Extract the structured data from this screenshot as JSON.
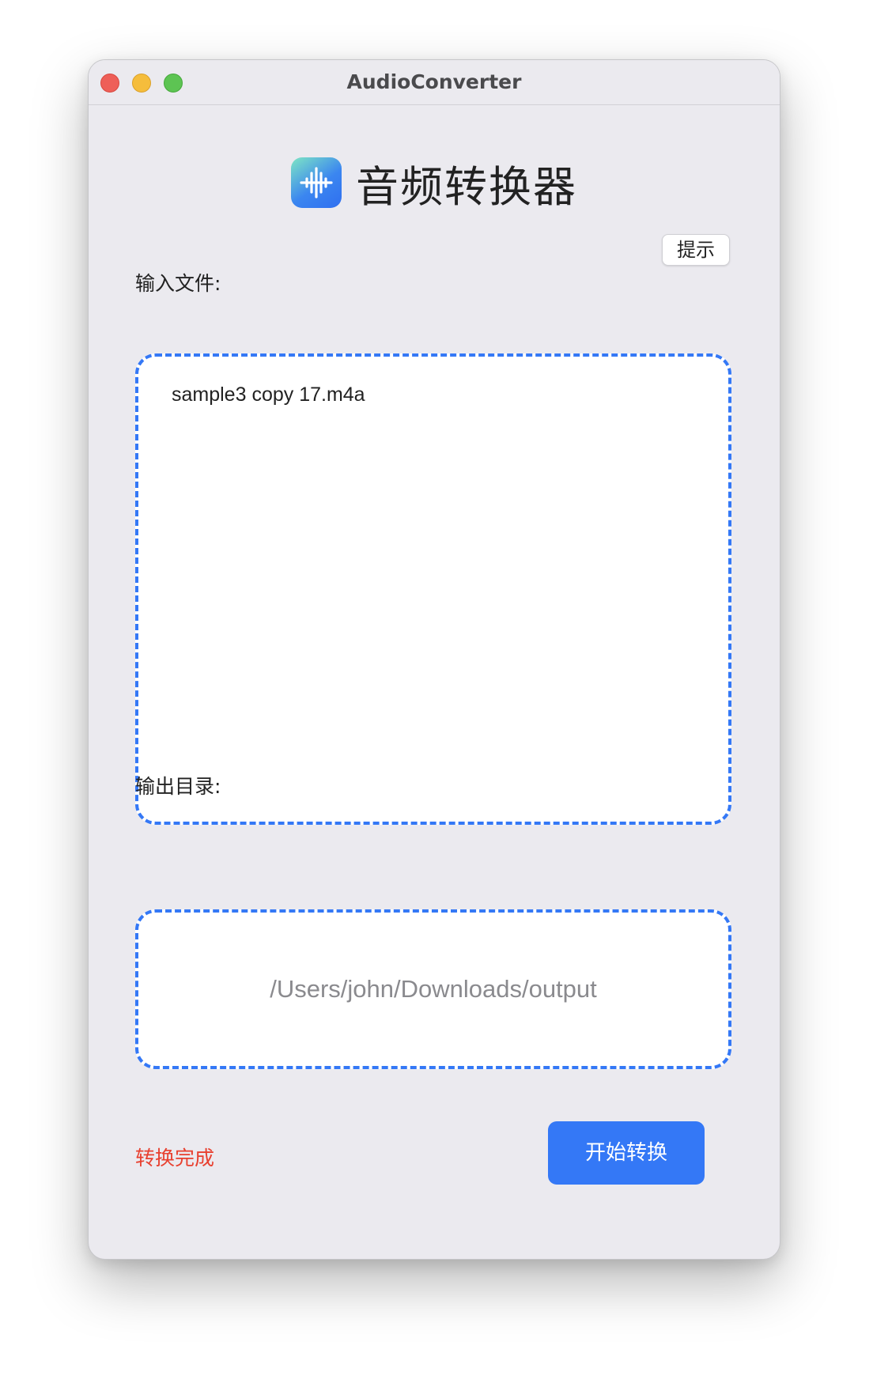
{
  "window": {
    "title": "AudioConverter"
  },
  "header": {
    "app_title": "音频转换器",
    "icon": "waveform-app-icon"
  },
  "toolbar": {
    "hint_label": "提示"
  },
  "input": {
    "label": "输入文件:",
    "files": [
      "sample3 copy 17.m4a"
    ]
  },
  "output": {
    "label": "输出目录:",
    "path": "/Users/john/Downloads/output"
  },
  "footer": {
    "status": "转换完成",
    "start_label": "开始转换"
  },
  "colors": {
    "accent": "#3478f6",
    "status": "#e8402f",
    "window_bg": "#ebeaef"
  }
}
